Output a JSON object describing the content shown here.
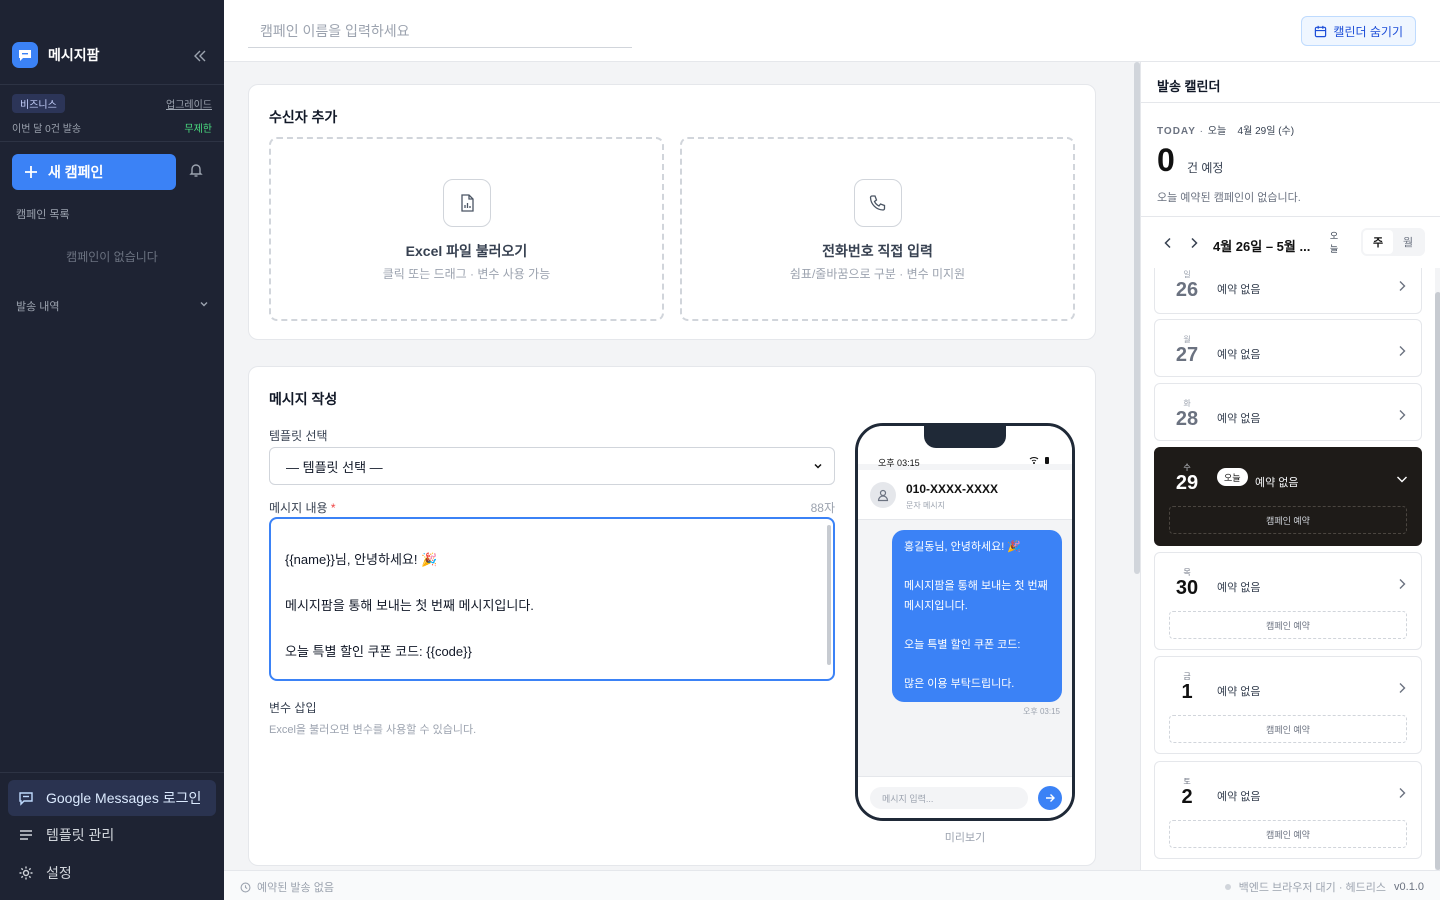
{
  "app": {
    "name": "메시지팜"
  },
  "plan": {
    "badge": "비즈니스",
    "upgrade": "업그레이드",
    "usage": "이번 달 0건 발송",
    "limit": "무제한"
  },
  "sidebar": {
    "new_campaign": "새 캠페인",
    "campaign_list_label": "캠페인 목록",
    "campaign_empty": "캠페인이 없습니다",
    "history_label": "발송 내역",
    "bottom": [
      {
        "label": "Google Messages 로그인",
        "icon": "message-icon"
      },
      {
        "label": "템플릿 관리",
        "icon": "list-icon"
      },
      {
        "label": "설정",
        "icon": "gear-icon"
      }
    ]
  },
  "topbar": {
    "campaign_name_placeholder": "캠페인 이름을 입력하세요",
    "hide_calendar": "캘린더 숨기기"
  },
  "recipients": {
    "title": "수신자 추가",
    "excel": {
      "title": "Excel 파일 불러오기",
      "subtitle": "클릭 또는 드래그 · 변수 사용 가능"
    },
    "manual": {
      "title": "전화번호 직접 입력",
      "subtitle": "쉼표/줄바꿈으로 구분 · 변수 미지원"
    }
  },
  "compose": {
    "title": "메시지 작성",
    "template_label": "템플릿 선택",
    "template_value": "— 템플릿 선택 —",
    "content_label": "메시지 내용",
    "required_mark": "*",
    "char_count": "88자",
    "content": "{{name}}님, 안녕하세요! 🎉\n\n메시지팜을 통해 보내는 첫 번째 메시지입니다.\n\n오늘 특별 할인 쿠폰 코드: {{code}}\n\n많은 이용 부탁드립니다.",
    "variables_label": "변수 삽입",
    "variables_hint": "Excel을 불러오면 변수를 사용할 수 있습니다."
  },
  "preview": {
    "time": "오후 03:15",
    "number": "010-XXXX-XXXX",
    "type": "문자 메시지",
    "bubble": "홍길동님, 안녕하세요! 🎉\n\n메시지팜을 통해 보내는 첫 번째 메시지입니다.\n\n오늘 특별 할인 쿠폰 코드:\n\n많은 이용 부탁드립니다.",
    "bubble_time": "오후 03:15",
    "input_placeholder": "메시지 입력...",
    "label": "미리보기"
  },
  "calendar": {
    "title": "발송 캘린더",
    "today_label": "TODAY",
    "today_word": "오늘",
    "today_date": "4월 29일 (수)",
    "count": "0",
    "count_unit": "건 예정",
    "today_empty": "오늘 예약된 캠페인이 없습니다.",
    "range": "4월 26일 – 5월 ...",
    "today_btn": "오늘",
    "view_week": "주",
    "view_month": "월",
    "days": [
      {
        "dow": "일",
        "num": "26",
        "status": "예약 없음"
      },
      {
        "dow": "월",
        "num": "27",
        "status": "예약 없음"
      },
      {
        "dow": "화",
        "num": "28",
        "status": "예약 없음"
      },
      {
        "dow": "수",
        "num": "29",
        "status": "예약 없음",
        "badge": "오늘",
        "action": "캠페인 예약"
      },
      {
        "dow": "목",
        "num": "30",
        "status": "예약 없음",
        "action": "캠페인 예약"
      },
      {
        "dow": "금",
        "num": "1",
        "status": "예약 없음",
        "action": "캠페인 예약"
      },
      {
        "dow": "토",
        "num": "2",
        "status": "예약 없음",
        "action": "캠페인 예약"
      }
    ]
  },
  "statusbar": {
    "left": "예약된 발송 없음",
    "right": "백엔드 브라우저 대기 · 헤드리스",
    "version": "v0.1.0"
  }
}
